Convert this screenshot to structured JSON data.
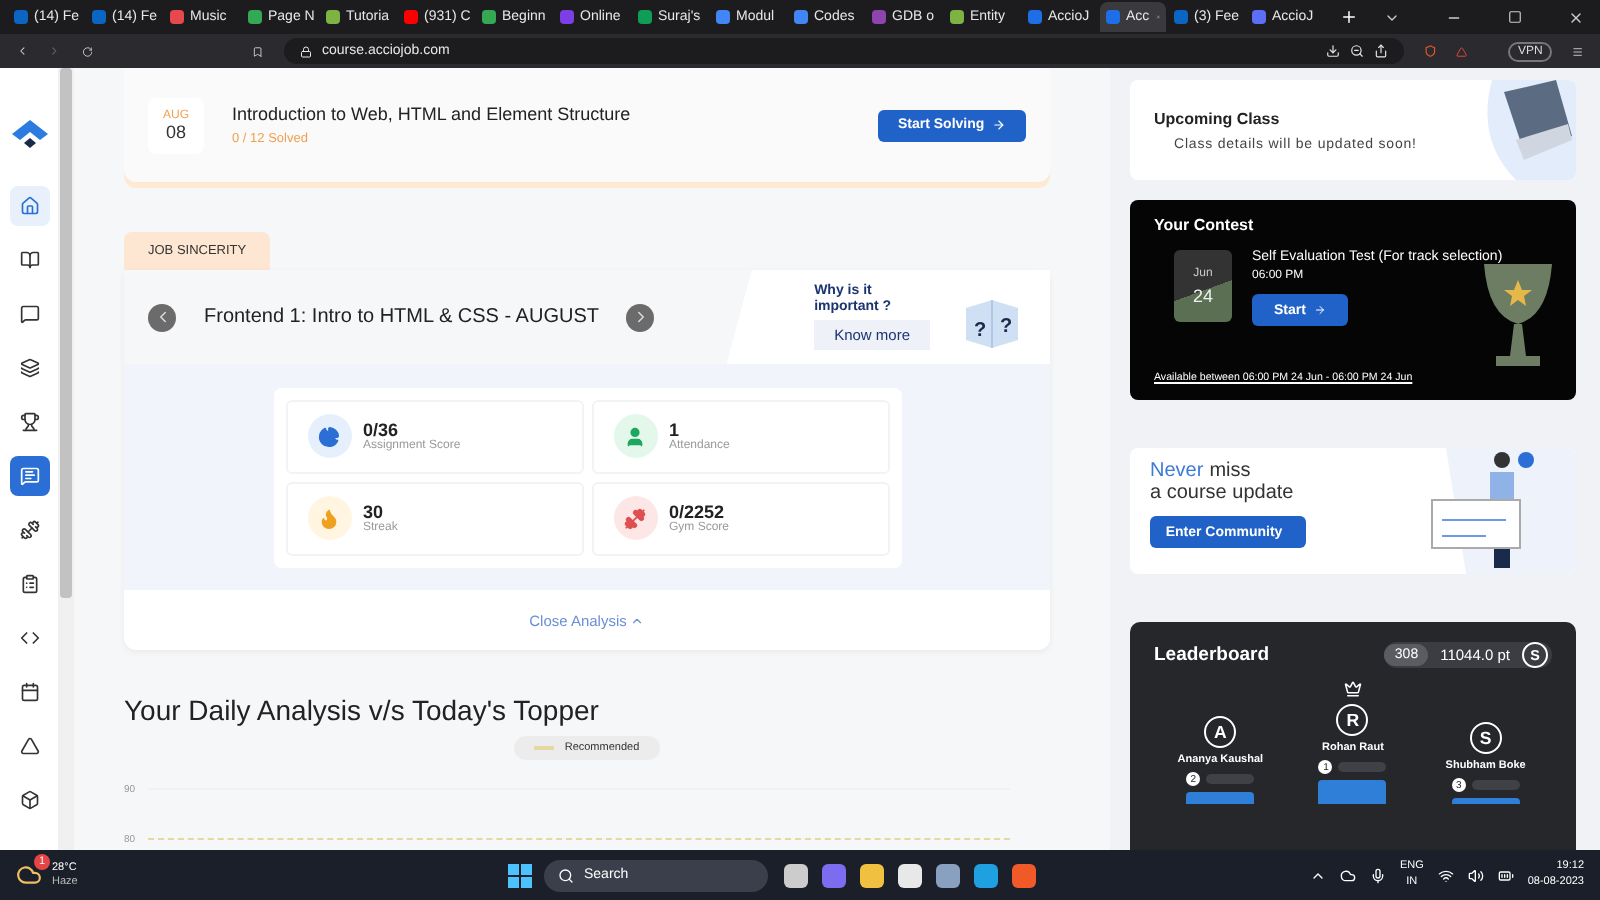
{
  "browser": {
    "tabs": [
      {
        "title": "(14) Fe",
        "color": "#0a66c2",
        "selected": false
      },
      {
        "title": "(14) Fe",
        "color": "#0a66c2",
        "selected": false
      },
      {
        "title": "Music",
        "color": "#e5484d",
        "selected": false
      },
      {
        "title": "Page N",
        "color": "#34a853",
        "selected": false
      },
      {
        "title": "Tutoria",
        "color": "#7cb342",
        "selected": false
      },
      {
        "title": "(931) C",
        "color": "#ff0000",
        "selected": false
      },
      {
        "title": "Beginn",
        "color": "#34a853",
        "selected": false
      },
      {
        "title": "Online",
        "color": "#7b3fe4",
        "selected": false
      },
      {
        "title": "Suraj's",
        "color": "#0f9d58",
        "selected": false
      },
      {
        "title": "Modul",
        "color": "#4285f4",
        "selected": false
      },
      {
        "title": "Codes",
        "color": "#4285f4",
        "selected": false
      },
      {
        "title": "GDB o",
        "color": "#8e44ad",
        "selected": false
      },
      {
        "title": "Entity",
        "color": "#7cb342",
        "selected": false
      },
      {
        "title": "AccioJ",
        "color": "#1e6ee8",
        "selected": false
      },
      {
        "title": "Acc",
        "color": "#1e6ee8",
        "selected": true
      },
      {
        "title": "(3) Fee",
        "color": "#0a66c2",
        "selected": false
      },
      {
        "title": "AccioJ",
        "color": "#5b6ef5",
        "selected": false
      }
    ],
    "url": "course.acciojob.com",
    "vpn": "VPN"
  },
  "sidebar": {
    "items": [
      {
        "kind": "plain",
        "selected": true
      },
      {
        "kind": "plain",
        "selected": false
      },
      {
        "kind": "plain",
        "selected": false
      },
      {
        "kind": "plain",
        "selected": false
      },
      {
        "kind": "plain",
        "selected": false
      },
      {
        "kind": "accent",
        "selected": false
      },
      {
        "kind": "plain",
        "selected": false
      },
      {
        "kind": "plain",
        "selected": false
      },
      {
        "kind": "plain",
        "selected": false
      },
      {
        "kind": "plain",
        "selected": false
      },
      {
        "kind": "plain",
        "selected": false
      },
      {
        "kind": "plain",
        "selected": false
      }
    ]
  },
  "lesson": {
    "month": "AUG",
    "day": "08",
    "title": "Introduction to Web, HTML and Element Structure",
    "progress": "0 / 12 Solved",
    "completed": false,
    "button": "Start Solving"
  },
  "job_sincerity": {
    "tab": "JOB SINCERITY",
    "course": "Frontend 1: Intro to HTML & CSS - AUGUST",
    "why": "Why is it important ?",
    "know_more": "Know more",
    "cube_marks": [
      "?",
      "?"
    ],
    "stats": [
      {
        "kind": "assignment",
        "value": "0/36",
        "label": "Assignment Score"
      },
      {
        "kind": "attendance",
        "value": "1",
        "label": "Attendance"
      },
      {
        "kind": "streak",
        "value": "30",
        "label": "Streak"
      },
      {
        "kind": "gym",
        "value": "0/2252",
        "label": "Gym Score"
      }
    ],
    "close": "Close Analysis"
  },
  "daily_analysis": {
    "title": "Your Daily Analysis v/s Today's Topper",
    "legend": "Recommended",
    "axis_labels": [
      "90",
      "80"
    ]
  },
  "upcoming_class": {
    "title": "Upcoming Class",
    "text": "Class details will be updated soon!"
  },
  "contest": {
    "title": "Your Contest",
    "month": "Jun",
    "day": "24",
    "name": "Self Evaluation Test (For track selection)",
    "time": "06:00 PM",
    "button": "Start",
    "availability": "Available between 06:00 PM 24 Jun - 06:00 PM 24 Jun"
  },
  "community": {
    "accent": "Never",
    "rest": "miss",
    "line2": "a course update",
    "button": "Enter Community"
  },
  "leaderboard": {
    "title": "Leaderboard",
    "rank": "308",
    "points": "11044.0 pt",
    "avatar": "S",
    "podium": [
      {
        "initial": "A",
        "name": "Ananya Kaushal",
        "place": "2"
      },
      {
        "initial": "R",
        "name": "Rohan Raut",
        "place": "1"
      },
      {
        "initial": "S",
        "name": "Shubham Boke",
        "place": "3"
      }
    ]
  },
  "taskbar": {
    "temperature": "28°C",
    "weather": "Haze",
    "badge": "1",
    "search": "Search",
    "lang": "ENG",
    "region": "IN",
    "time": "19:12",
    "date": "08-08-2023"
  }
}
